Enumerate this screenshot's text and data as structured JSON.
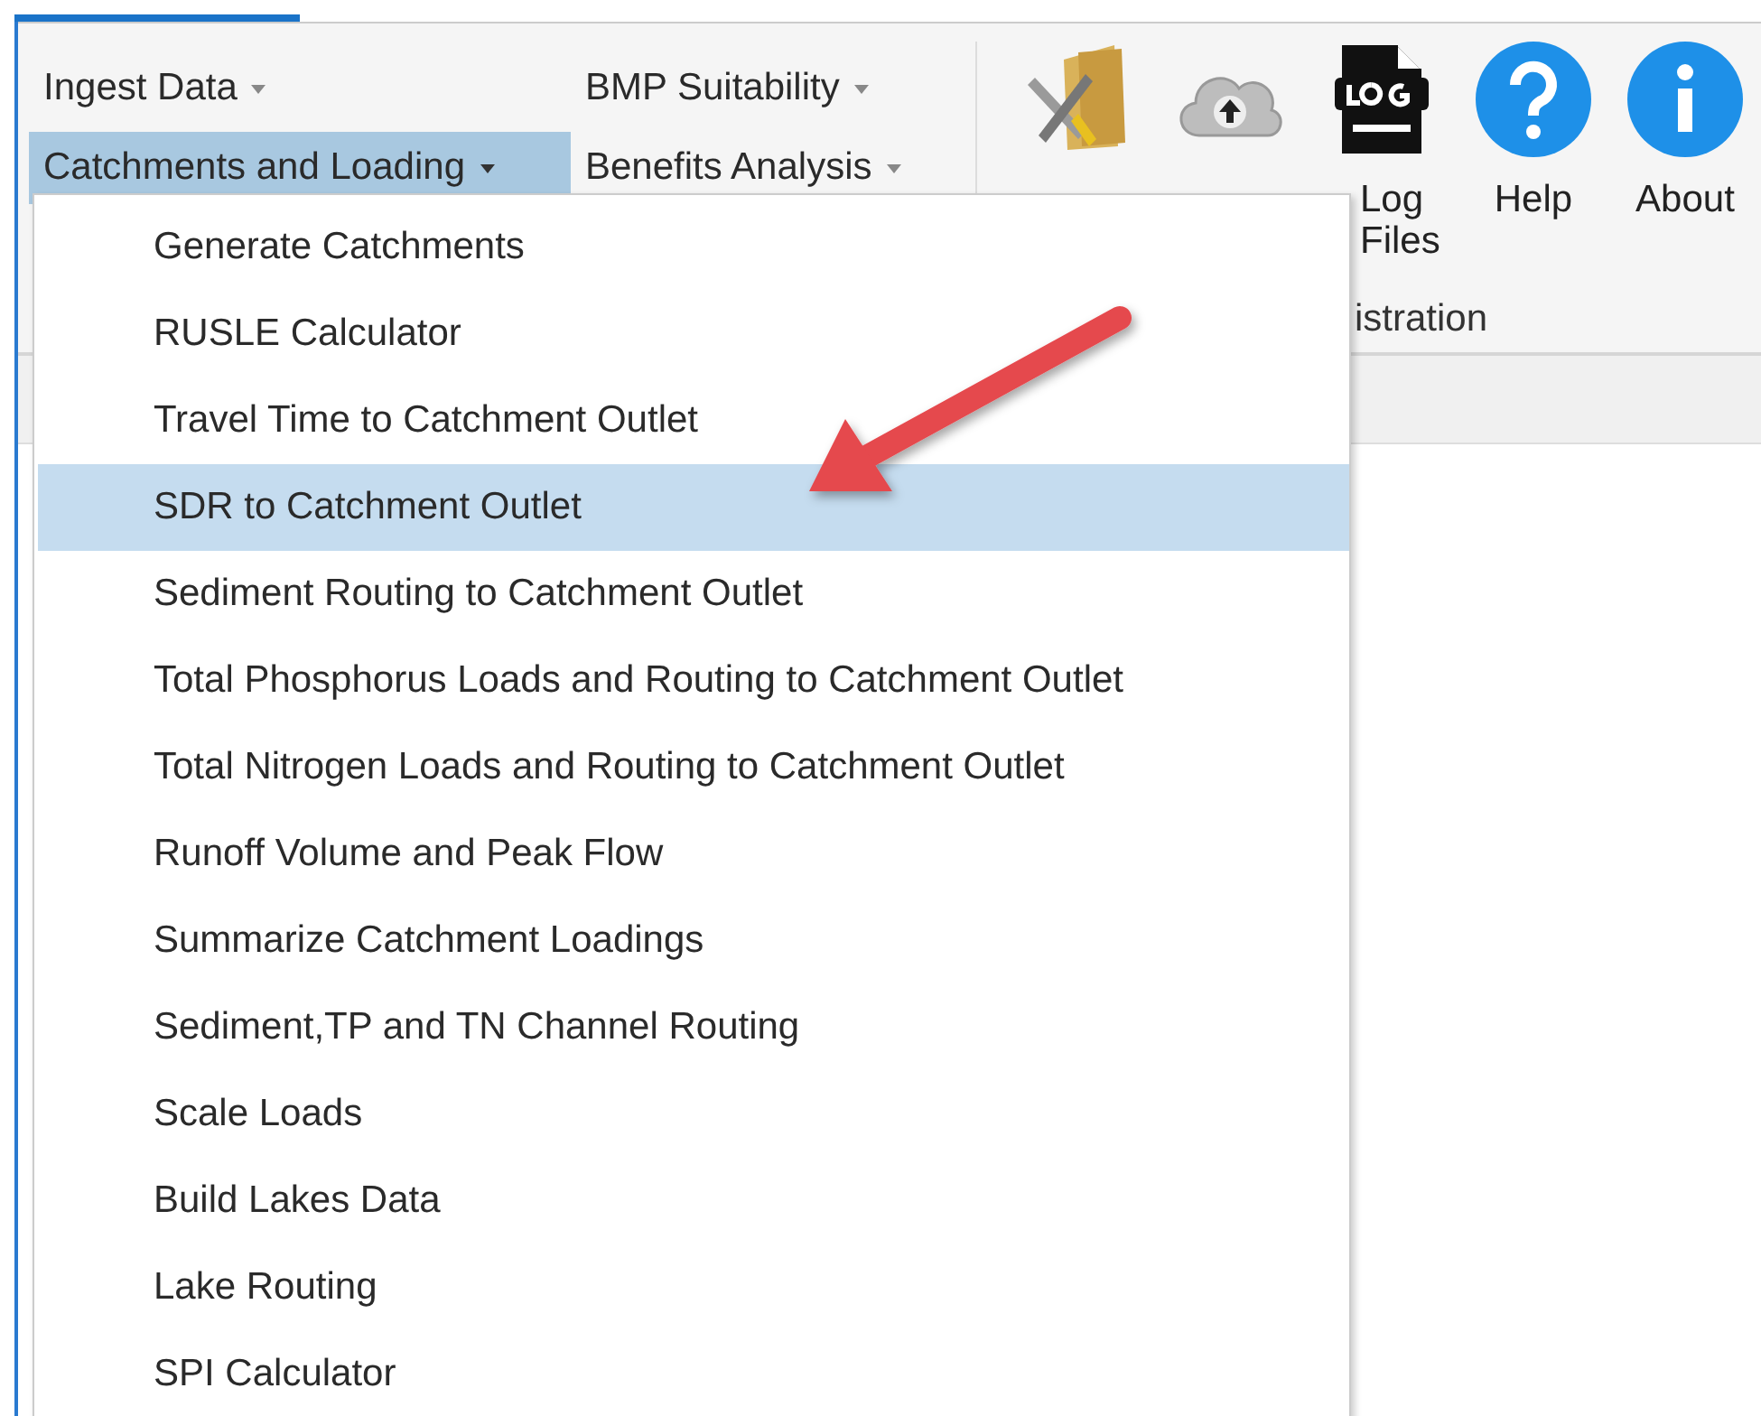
{
  "ribbon": {
    "menu_buttons": [
      {
        "label": "Ingest Data",
        "selected": false
      },
      {
        "label": "BMP Suitability",
        "selected": false
      },
      {
        "label": "Catchments and Loading",
        "selected": true
      },
      {
        "label": "Benefits Analysis",
        "selected": false
      }
    ],
    "tools": [
      {
        "kind": "settings"
      },
      {
        "kind": "extract"
      },
      {
        "kind": "log",
        "label": "Log Files"
      },
      {
        "kind": "help",
        "label": "Help"
      },
      {
        "kind": "about",
        "label": "About"
      }
    ],
    "group_label": "istration"
  },
  "menu": {
    "items": [
      {
        "label": "Generate Catchments",
        "selected": false
      },
      {
        "label": "RUSLE Calculator",
        "selected": false
      },
      {
        "label": "Travel Time to Catchment Outlet",
        "selected": false
      },
      {
        "label": "SDR to Catchment Outlet",
        "selected": true
      },
      {
        "label": "Sediment Routing to Catchment Outlet",
        "selected": false
      },
      {
        "label": "Total Phosphorus Loads and Routing to Catchment Outlet",
        "selected": false
      },
      {
        "label": "Total Nitrogen Loads and Routing to Catchment Outlet",
        "selected": false
      },
      {
        "label": "Runoff Volume and Peak Flow",
        "selected": false
      },
      {
        "label": "Summarize Catchment Loadings",
        "selected": false
      },
      {
        "label": "Sediment,TP and TN Channel Routing",
        "selected": false
      },
      {
        "label": "Scale Loads",
        "selected": false
      },
      {
        "label": "Build Lakes Data",
        "selected": false
      },
      {
        "label": "Lake Routing",
        "selected": false
      },
      {
        "label": "SPI Calculator",
        "selected": false
      }
    ]
  },
  "annotation": {
    "kind": "arrow"
  }
}
